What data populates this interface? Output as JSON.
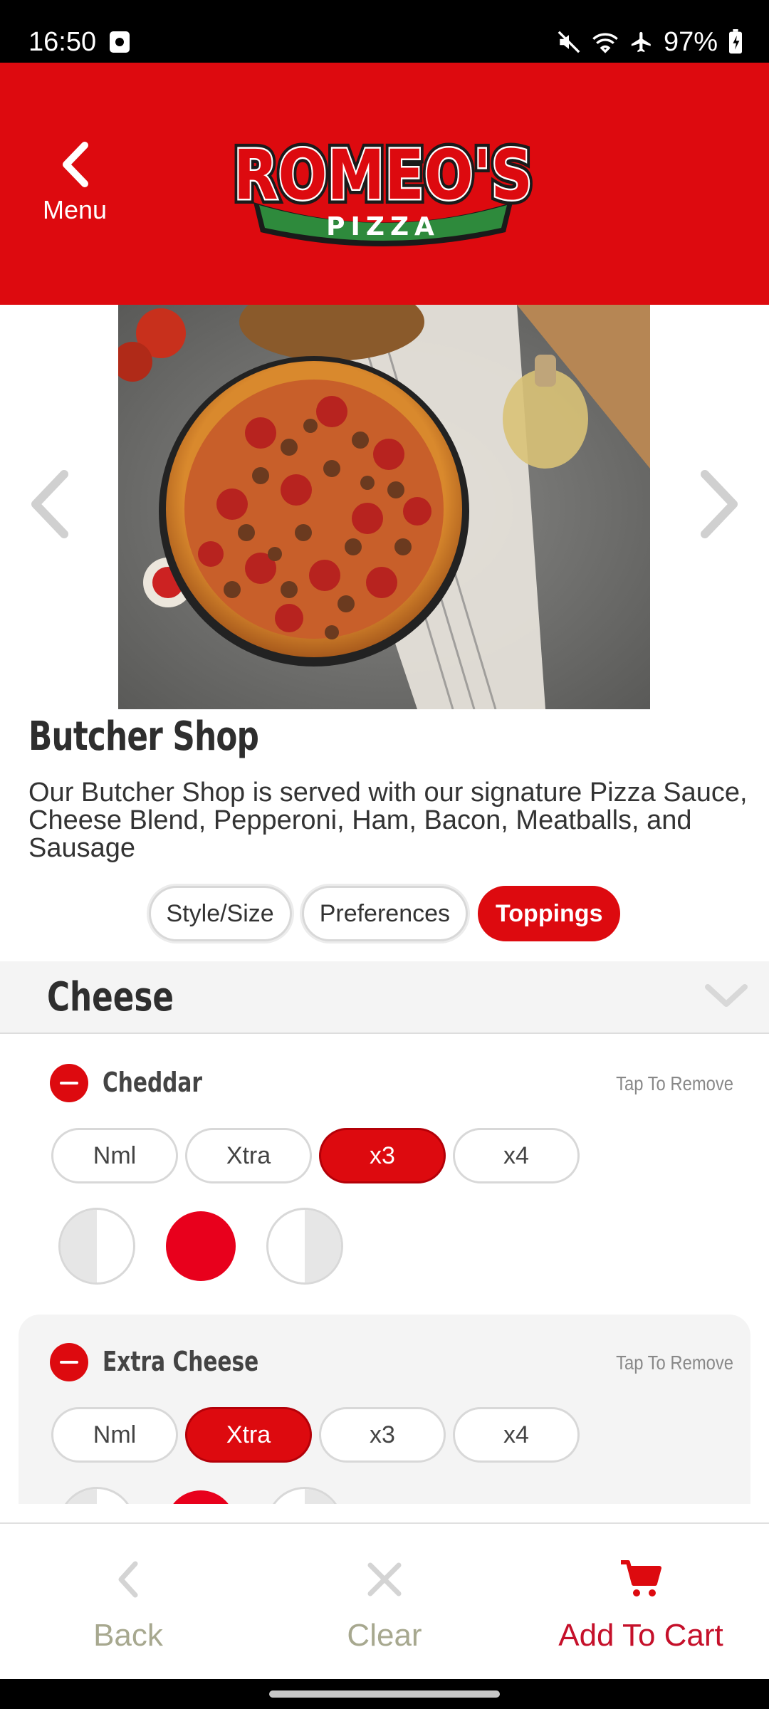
{
  "status_bar": {
    "time": "16:50",
    "battery": "97%",
    "icons": [
      "mute-icon",
      "wifi-icon",
      "airplane-icon",
      "battery-charging-icon"
    ]
  },
  "header": {
    "back_label": "Menu",
    "logo_top": "ROMEO'S",
    "logo_bottom": "PIZZA",
    "brand_color": "#dd0a0f"
  },
  "product": {
    "name": "Butcher Shop",
    "description": "Our Butcher Shop is served with our signature Pizza Sauce, Cheese Blend, Pepperoni, Ham, Bacon, Meatballs, and Sausage"
  },
  "tabs": [
    {
      "label": "Style/Size",
      "active": false
    },
    {
      "label": "Preferences",
      "active": false
    },
    {
      "label": "Toppings",
      "active": true
    }
  ],
  "section": {
    "title": "Cheese"
  },
  "toppings": [
    {
      "name": "Cheddar",
      "hint": "Tap To Remove",
      "amounts": [
        "Nml",
        "Xtra",
        "x3",
        "x4"
      ],
      "selected_amount": "x3",
      "portion": "whole"
    },
    {
      "name": "Extra Cheese",
      "hint": "Tap To Remove",
      "amounts": [
        "Nml",
        "Xtra",
        "x3",
        "x4"
      ],
      "selected_amount": "Xtra",
      "portion": "whole"
    }
  ],
  "bottom_bar": {
    "back": "Back",
    "clear": "Clear",
    "add_to_cart": "Add To Cart"
  }
}
